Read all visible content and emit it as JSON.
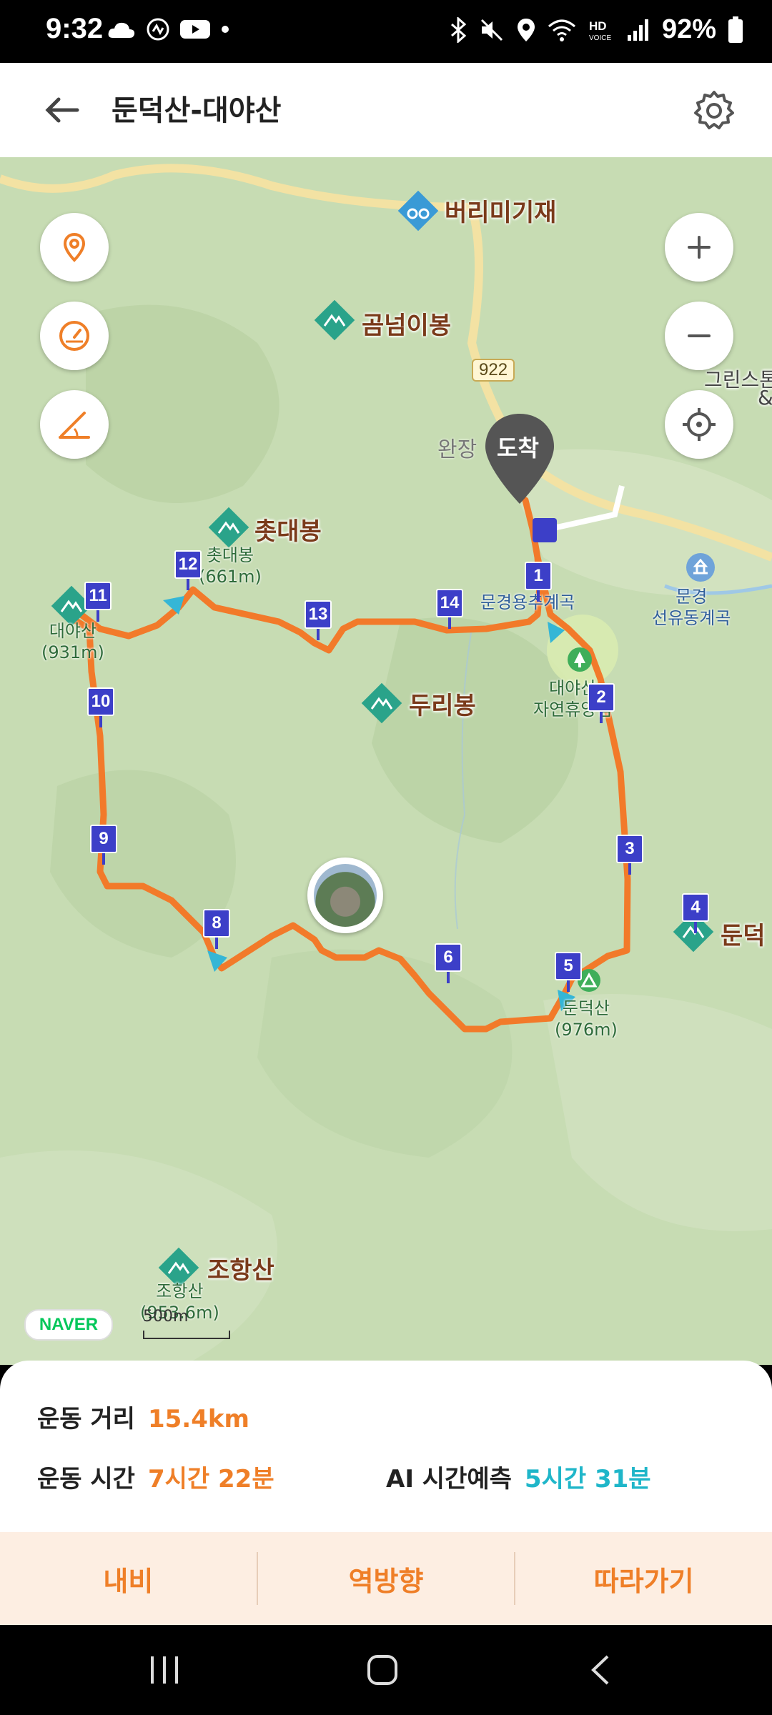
{
  "status": {
    "time": "9:32",
    "battery": "92%"
  },
  "header": {
    "title": "둔덕산-대야산"
  },
  "map": {
    "labels": {
      "burimigije": "버리미기재",
      "gomnumibong": "곰넘이봉",
      "road922": "922",
      "wanjang": "완장",
      "arrival": "도착",
      "chotdaebong": "촛대봉",
      "chotdaebong_sub1": "촛대봉",
      "chotdaebong_sub2": "(661m)",
      "daeyasan_sub1": "대야산",
      "daeyasan_sub2": "(931m)",
      "duribong": "두리봉",
      "mungyeong_valley": "문경용추계곡",
      "forest1": "대야산",
      "forest2": "자연휴양림",
      "mungyeong1": "문경",
      "mungyeong2": "선유동계곡",
      "greens1": "그린스톤",
      "greens2": "&",
      "dundeok": "둔덕",
      "dundeoksan_sub1": "둔덕산",
      "dundeoksan_sub2": "(976m)",
      "johangsan": "조항산",
      "johangsan_sub1": "조항산",
      "johangsan_sub2": "(953.6m)",
      "naver": "NAVER",
      "scale": "500m"
    },
    "markers": [
      "1",
      "2",
      "3",
      "4",
      "5",
      "6",
      "8",
      "9",
      "10",
      "11",
      "12",
      "13",
      "14"
    ]
  },
  "stats": {
    "distance_label": "운동 거리",
    "distance_value": "15.4km",
    "time_label": "운동 시간",
    "time_value": "7시간 22분",
    "ai_label": "AI 시간예측",
    "ai_value": "5시간 31분"
  },
  "actions": {
    "nav": "내비",
    "reverse": "역방향",
    "follow": "따라가기"
  },
  "colors": {
    "route": "#f27a2a",
    "accent": "#ef7f28",
    "teal": "#1fb6c9",
    "marker": "#3c3fc8"
  }
}
